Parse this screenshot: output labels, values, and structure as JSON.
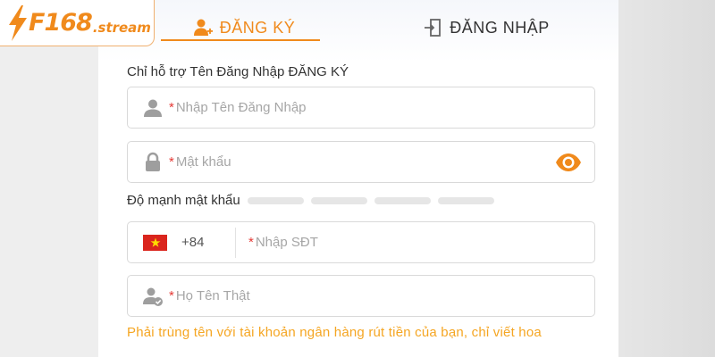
{
  "logo": {
    "brand": "F168",
    "suffix": ".stream"
  },
  "tabs": {
    "register": {
      "label": "ĐĂNG KÝ",
      "icon": "user-add-icon"
    },
    "login": {
      "label": "ĐĂNG NHẬP",
      "icon": "login-door-icon"
    }
  },
  "form": {
    "section_label": "Chỉ hỗ trợ Tên Đăng Nhập ĐĂNG KÝ",
    "required_mark": "*",
    "username": {
      "placeholder": "Nhập Tên Đăng Nhập",
      "value": "",
      "icon": "user-icon"
    },
    "password": {
      "placeholder": "Mật khẩu",
      "value": "",
      "icon": "lock-icon",
      "toggle_icon": "eye-icon"
    },
    "strength": {
      "label": "Độ mạnh mật khẩu",
      "bars": 4,
      "filled": 0
    },
    "phone": {
      "country_code": "+84",
      "flag": "vietnam-flag-icon",
      "placeholder": "Nhập SĐT",
      "value": ""
    },
    "real_name": {
      "placeholder": "Họ Tên Thật",
      "value": "",
      "icon": "user-check-icon"
    },
    "hint": "Phải trùng tên với tài khoản ngân hàng rút tiền của bạn, chỉ viết hoa"
  },
  "colors": {
    "accent": "#f08a1c",
    "hint": "#f5a623",
    "required": "#e53935",
    "flag_red": "#da251d",
    "flag_star": "#ffde00"
  }
}
